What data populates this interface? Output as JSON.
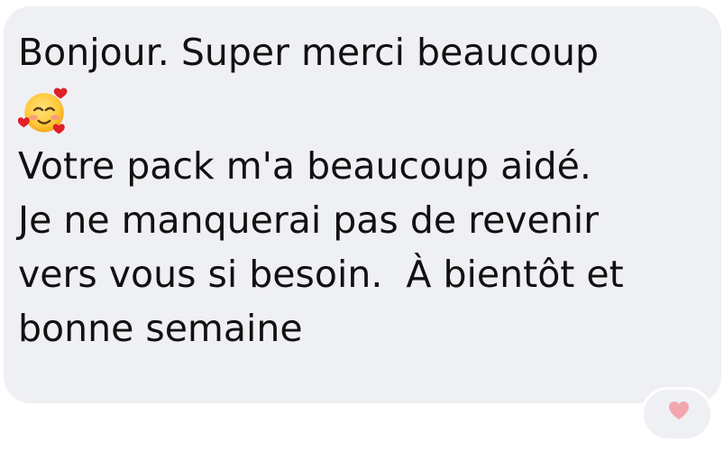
{
  "message": {
    "line1": "Bonjour. Super merci beaucoup",
    "emoji": "smiling-face-with-hearts",
    "line3": "Votre pack m'a beaucoup aidé.",
    "line4": "Je ne manquerai pas de revenir",
    "line5": "vers vous si besoin.  À bientôt et",
    "line6": "bonne semaine"
  },
  "reaction": {
    "icon": "heart-icon",
    "color": "#f2a7b0"
  },
  "colors": {
    "bubble": "#eff0f4",
    "text": "#111111",
    "background": "#ffffff"
  }
}
